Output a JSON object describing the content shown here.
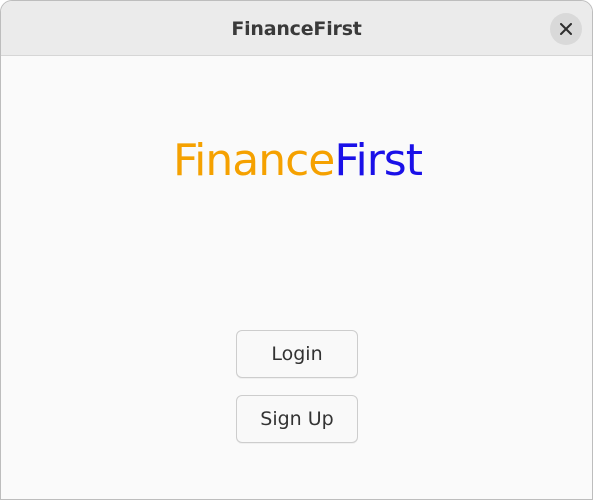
{
  "window": {
    "title": "FinanceFirst"
  },
  "logo": {
    "part1": "Finance",
    "part2": "First",
    "colors": {
      "part1": "#f5a100",
      "part2": "#1a10e8"
    }
  },
  "buttons": {
    "login_label": "Login",
    "signup_label": "Sign Up"
  },
  "icons": {
    "close": "close-icon"
  }
}
